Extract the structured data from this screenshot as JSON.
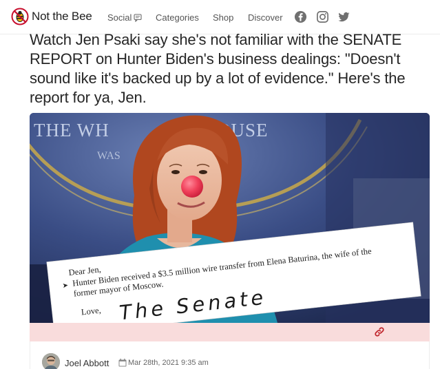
{
  "site": {
    "name": "Not the Bee"
  },
  "nav": {
    "items": [
      {
        "label": "Social"
      },
      {
        "label": "Categories"
      },
      {
        "label": "Shop"
      },
      {
        "label": "Discover"
      }
    ],
    "social_icons": [
      "facebook-icon",
      "instagram-icon",
      "twitter-icon"
    ]
  },
  "article": {
    "headline": "Watch Jen Psaki say she's not familiar with the SENATE REPORT on Hunter Biden's business dealings: \"Doesn't sound like it's backed up by a lot of evidence.\" Here's the report for ya, Jen.",
    "image": {
      "backdrop_text_1": "THE WH",
      "backdrop_text_2": "OUSE",
      "backdrop_text_3": "WAS",
      "note": {
        "greeting": "Dear Jen,",
        "line_1": "Hunter Biden received a $3.5 million wire transfer from Elena Baturina, the wife of the",
        "line_2": "former mayor of Moscow.",
        "signoff": "Love,",
        "signature": "The Senate"
      }
    },
    "author": {
      "name": "Joel Abbott"
    },
    "date": "Mar 28th, 2021 9:35 am"
  },
  "colors": {
    "caption_bar": "#f9dcdc",
    "link_icon": "#c0262d",
    "clown_nose": "#f0405a",
    "backdrop_blue": "#2e3f70"
  }
}
